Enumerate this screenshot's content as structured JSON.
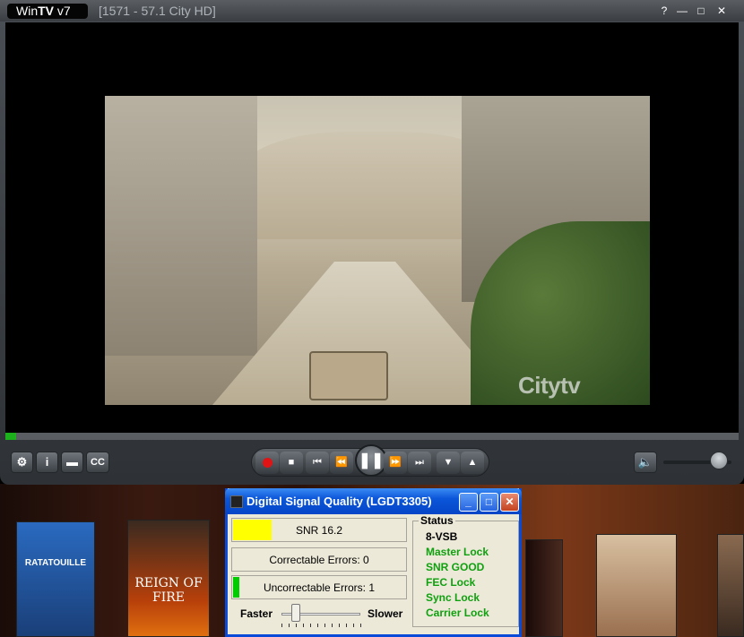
{
  "app": {
    "logo_prefix": "Win",
    "logo_brand": "TV",
    "logo_version": " v7",
    "channel": "[1571 - 57.1   City HD]",
    "window_buttons": {
      "help": "?",
      "minimize": "—",
      "maximize": "□",
      "close": "✕"
    }
  },
  "video": {
    "watermark": "Citytv",
    "playback_progress": 0.015
  },
  "toolbar": {
    "settings": "⚙",
    "info": "i",
    "folder": "▬",
    "cc": "CC"
  },
  "transport": {
    "stop": "■",
    "prev": "⏮",
    "rewind": "⏪",
    "pause": "❚❚",
    "fast_forward": "⏩",
    "next": "⏭",
    "channel_down": "▼",
    "channel_up": "▲"
  },
  "volume": {
    "icon": "🔈",
    "level": 0.82
  },
  "covers": [
    {
      "title": "RATATOUILLE",
      "color": "#1e5aa8"
    },
    {
      "title": "REIGN OF FIRE",
      "color": "#8a2a08"
    },
    {
      "title": "",
      "color": "#3a1a14"
    },
    {
      "title": "",
      "color": "#c0a080"
    },
    {
      "title": "",
      "color": "#5a4030"
    }
  ],
  "dialog": {
    "title": "Digital Signal Quality (LGDT3305)",
    "snr": {
      "label": "SNR 16.2",
      "fill": 0.22,
      "color": "#ffff00"
    },
    "correctable": {
      "label": "Correctable Errors:  0",
      "fill": 0,
      "color": "#00cc00"
    },
    "uncorrectable": {
      "label": "Uncorrectable Errors:  1",
      "fill": 0.035,
      "color": "#00cc00"
    },
    "speed": {
      "faster": "Faster",
      "slower": "Slower",
      "position": 0.18
    },
    "status": {
      "heading": "Status",
      "lines": [
        {
          "text": "8-VSB",
          "color": "#000000"
        },
        {
          "text": "Master Lock",
          "color": "#10a010"
        },
        {
          "text": "SNR GOOD",
          "color": "#10a010"
        },
        {
          "text": "FEC Lock",
          "color": "#10a010"
        },
        {
          "text": "Sync Lock",
          "color": "#10a010"
        },
        {
          "text": "Carrier Lock",
          "color": "#10a010"
        }
      ]
    },
    "buttons": {
      "minimize": "_",
      "maximize": "□",
      "close": "✕"
    }
  }
}
